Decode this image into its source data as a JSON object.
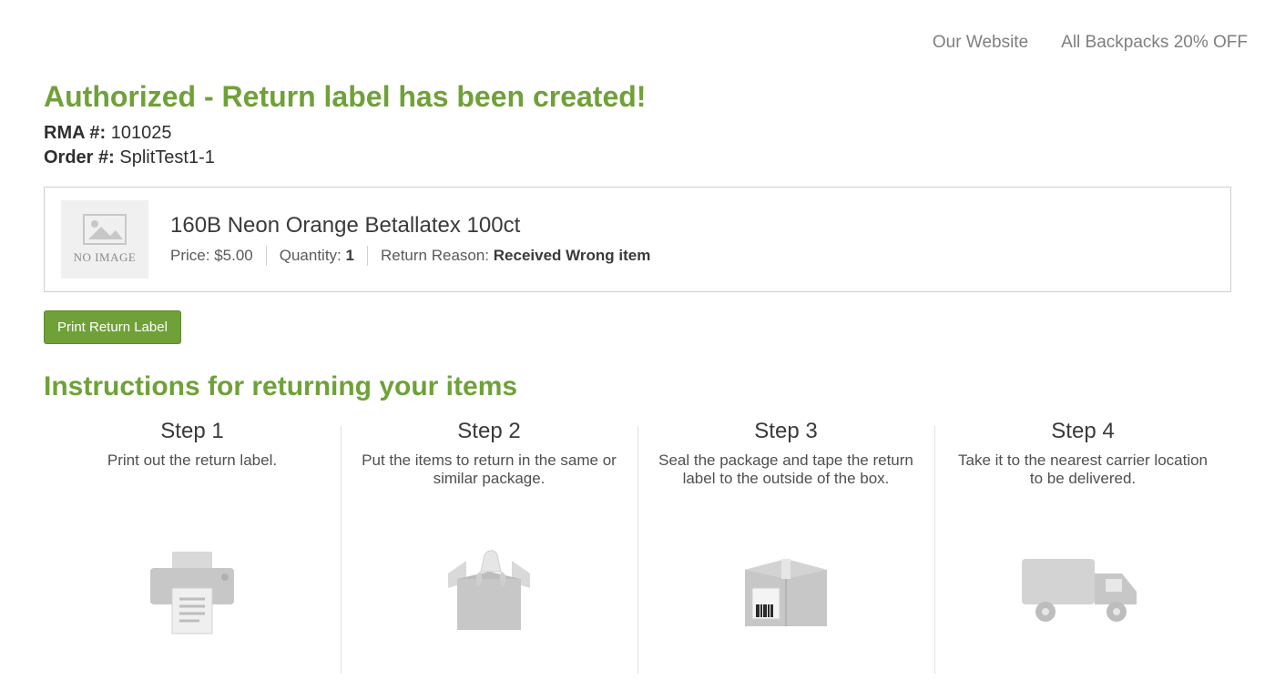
{
  "nav": {
    "links": [
      "Our Website",
      "All Backpacks 20% OFF"
    ]
  },
  "header": {
    "title": "Authorized - Return label has been created!",
    "rma_label": "RMA #:",
    "rma_value": "101025",
    "order_label": "Order #:",
    "order_value": "SplitTest1-1"
  },
  "item": {
    "no_image_text": "NO IMAGE",
    "name": "160B Neon Orange Betallatex 100ct",
    "price_label": "Price: ",
    "price_value": "$5.00",
    "qty_label": "Quantity: ",
    "qty_value": "1",
    "reason_label": "Return Reason: ",
    "reason_value": "Received Wrong item"
  },
  "print_button_label": "Print Return Label",
  "instructions": {
    "heading": "Instructions for returning your items",
    "steps": [
      {
        "title": "Step 1",
        "desc": "Print out the return label."
      },
      {
        "title": "Step 2",
        "desc": "Put the items to return in the same or similar package."
      },
      {
        "title": "Step 3",
        "desc": "Seal the package and tape the return label to the outside of the box."
      },
      {
        "title": "Step 4",
        "desc": "Take it to the nearest carrier location to be delivered."
      }
    ]
  }
}
